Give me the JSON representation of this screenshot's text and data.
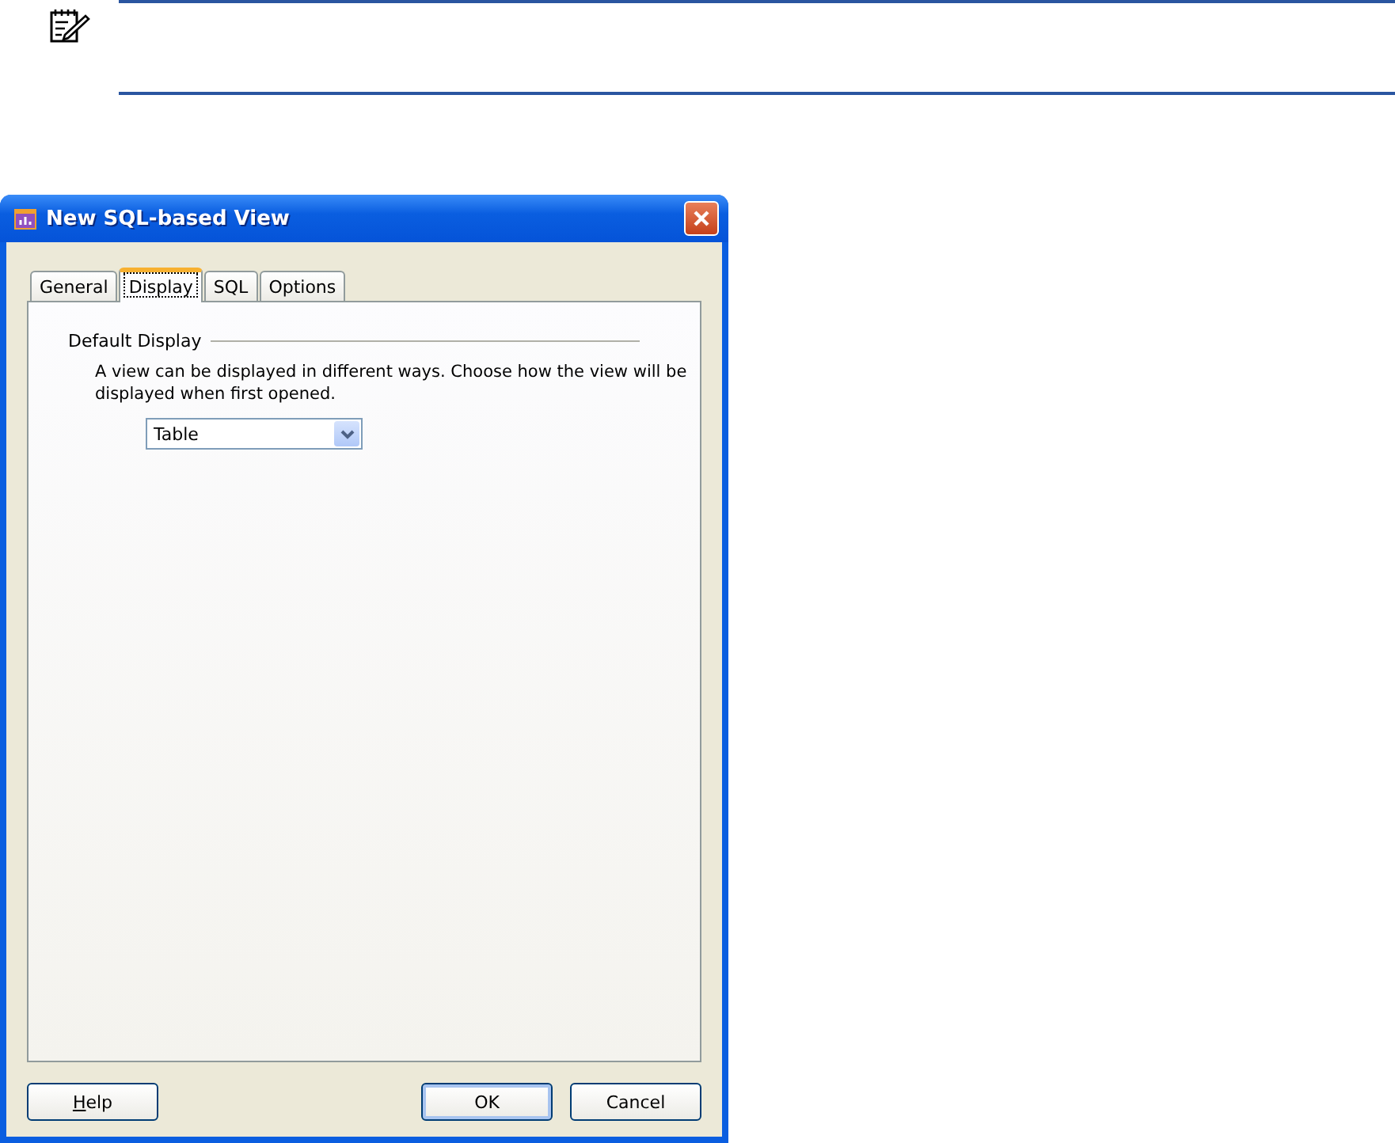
{
  "dialog": {
    "title": "New SQL-based View",
    "tabs": [
      {
        "label": "General",
        "selected": false
      },
      {
        "label": "Display",
        "selected": true
      },
      {
        "label": "SQL",
        "selected": false
      },
      {
        "label": "Options",
        "selected": false
      }
    ],
    "group": {
      "title": "Default Display",
      "description": "A view can be displayed in different ways. Choose how the view will be displayed when first opened.",
      "select": {
        "value": "Table"
      }
    },
    "buttons": [
      {
        "label": "Help",
        "kind": "help",
        "default": false
      },
      {
        "label": "OK",
        "kind": "ok",
        "default": true
      },
      {
        "label": "Cancel",
        "kind": "cancel",
        "default": false
      }
    ]
  }
}
